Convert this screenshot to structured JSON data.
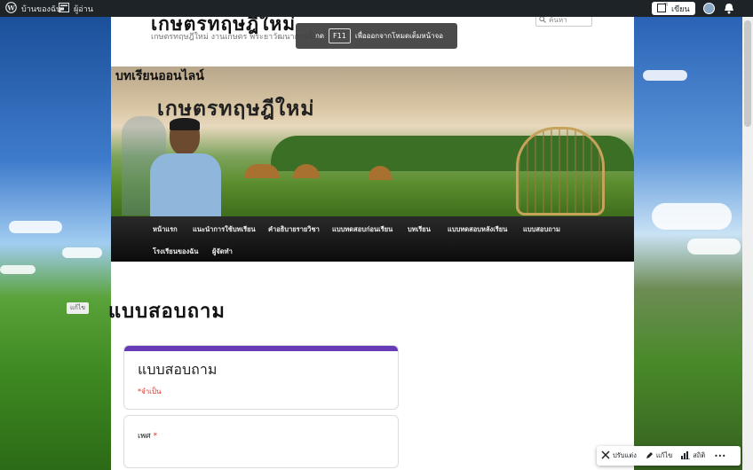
{
  "admin_bar": {
    "site_label": "บ้านของฉัน",
    "reader_label": "ผู้อ่าน",
    "write_label": "เขียน"
  },
  "site": {
    "title": "เกษตรทฤษฎีใหม่",
    "description": "เกษตรทฤษฎีใหม่ งานเกษตร พระยาวัฒนาการกิจ",
    "search_placeholder": "ค้นหา"
  },
  "fullscreen_notice": {
    "prefix": "กด",
    "key": "F11",
    "suffix": "เพื่อออกจากโหมดเต็มหน้าจอ"
  },
  "header_image": {
    "line1": "บทเรียนออนไลน์",
    "line2": "เกษตรทฤษฎีใหม่"
  },
  "nav": {
    "items": [
      "หน้าแรก",
      "แนะนำการใช้บทเรียน",
      "คำอธิบายรายวิชา",
      "แบบทดสอบก่อนเรียน",
      "บทเรียน",
      "แบบทดสอบหลังเรียน",
      "แบบสอบถาม",
      "โรงเรียนของฉัน",
      "ผู้จัดทำ"
    ]
  },
  "content": {
    "edit_label": "แก้ไข",
    "page_title": "แบบสอบถาม",
    "form": {
      "title": "แบบสอบถาม",
      "required_note": "*จำเป็น",
      "question1_label": "เพศ",
      "question1_star": "*"
    }
  },
  "bottom_toolbar": {
    "customize_label": "ปรับแต่ง",
    "edit_label": "แก้ไข",
    "stats_label": "สถิติ",
    "more_label": "•••"
  },
  "colors": {
    "admin_bar": "#1d2327",
    "form_accent": "#673ab7",
    "required": "#d93025"
  }
}
